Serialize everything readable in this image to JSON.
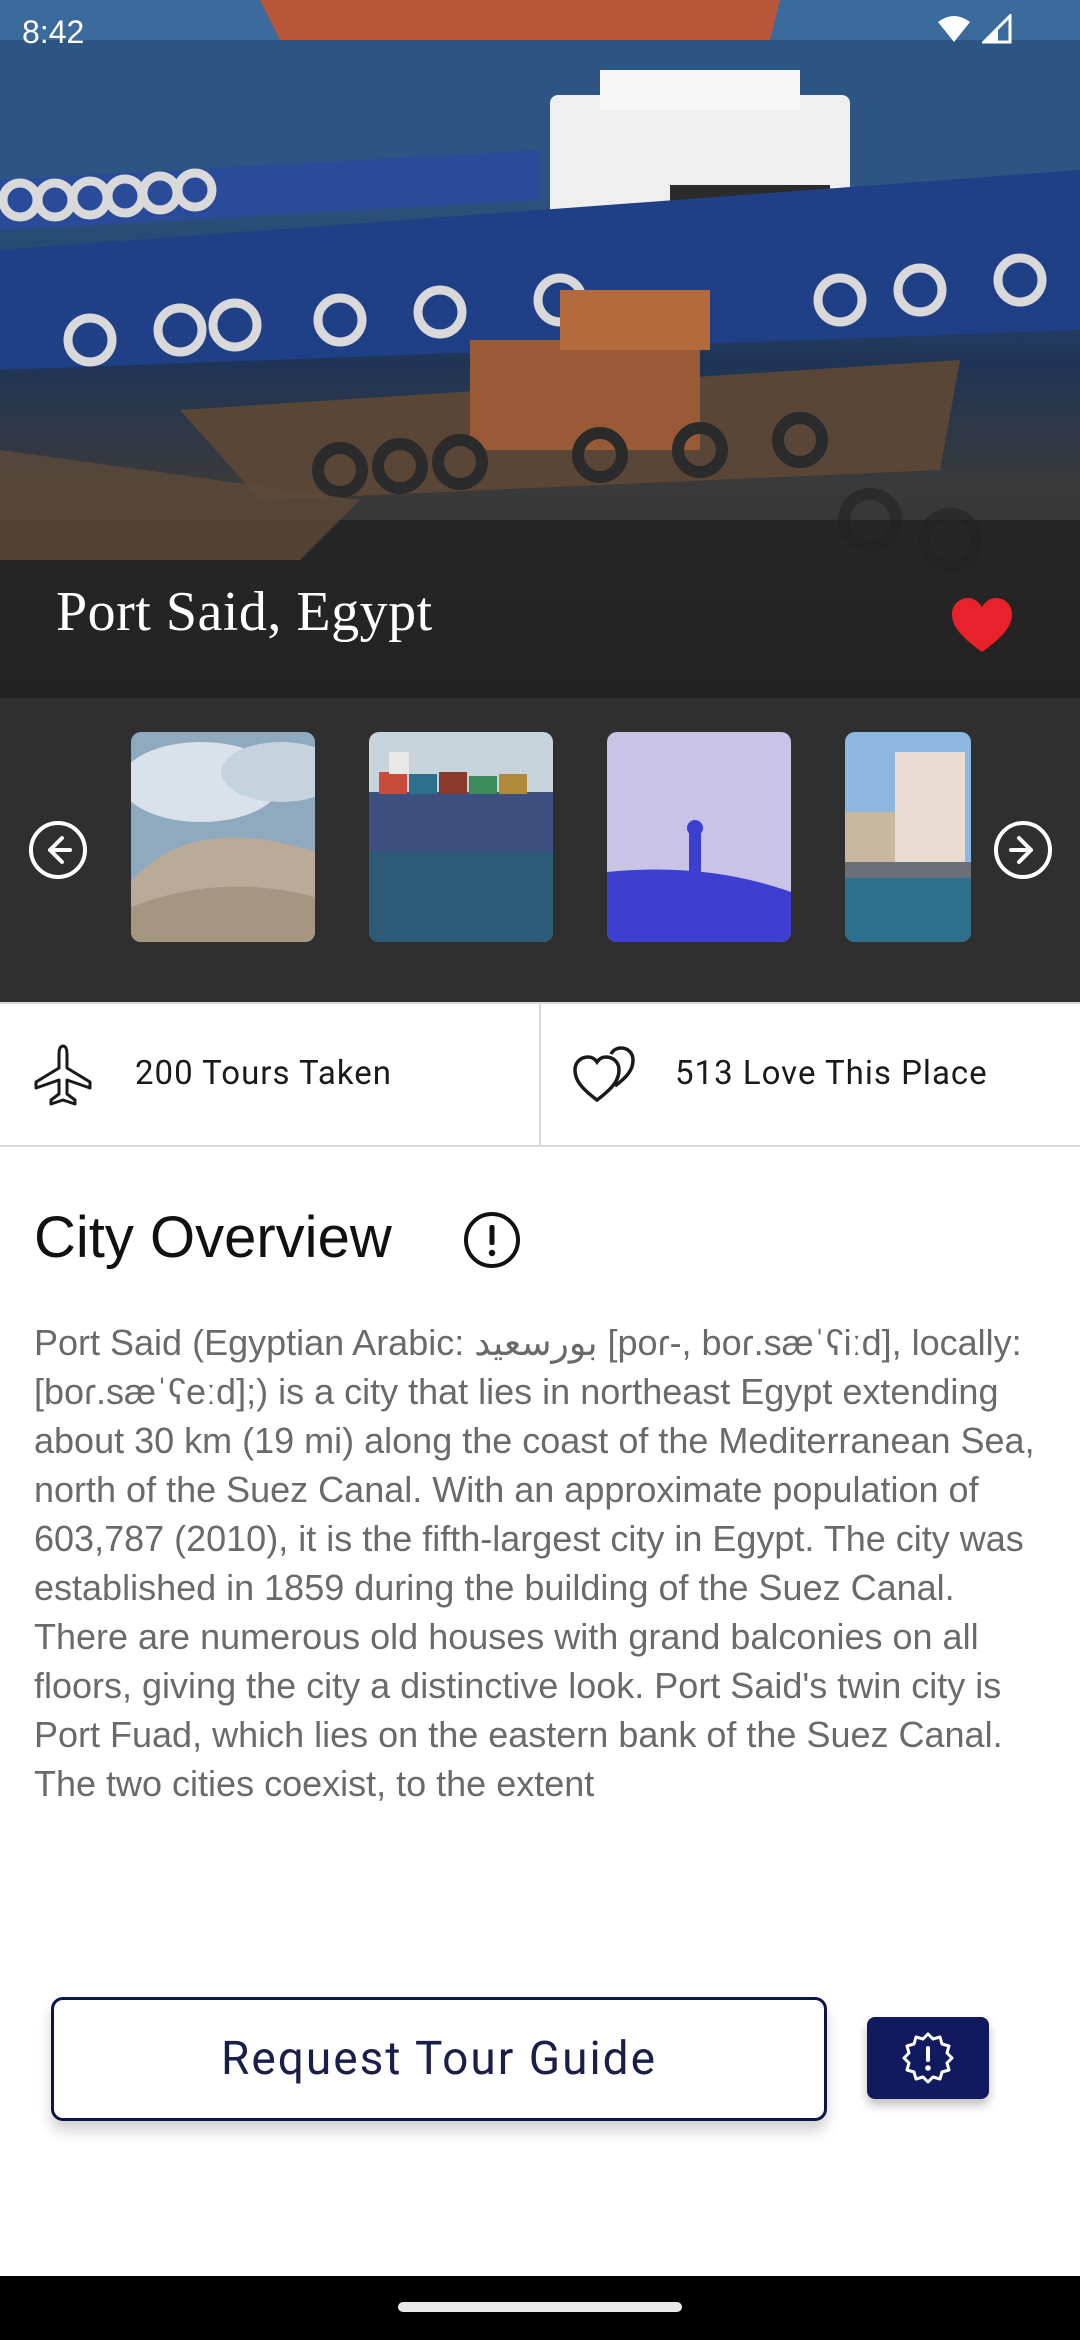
{
  "status_bar": {
    "time": "8:42"
  },
  "hero": {
    "title": "Port Said, Egypt",
    "favorite_icon": "heart-icon"
  },
  "gallery": {
    "prev_icon": "arrow-left-circle-icon",
    "next_icon": "arrow-right-circle-icon",
    "thumbnails": [
      "sand-dune",
      "container-ship",
      "shadow-on-sand",
      "waterfront-buildings"
    ]
  },
  "stats": {
    "tours": {
      "icon": "airplane-icon",
      "label": "200 Tours Taken"
    },
    "love": {
      "icon": "hearts-icon",
      "label": "513 Love This Place"
    }
  },
  "overview": {
    "title": "City Overview",
    "info_icon": "info-icon",
    "text": "Port Said (Egyptian Arabic: بورسعيد [poɾ-, boɾ.sæˈʕiːd], locally: [boɾ.sæˈʕeːd];) is a city that lies in northeast Egypt extending about 30 km (19 mi) along the coast of the Mediterranean Sea, north of the Suez Canal. With an approximate population of 603,787 (2010), it is the fifth-largest city in Egypt. The city was established in 1859 during the building of the Suez Canal.\nThere are numerous old houses with grand balconies on all floors, giving the city a distinctive look. Port Said's twin city is Port Fuad, which lies on the eastern bank of the Suez Canal. The two cities coexist, to the extent"
  },
  "actions": {
    "request_label": "Request Tour Guide",
    "report_icon": "report-icon"
  },
  "colors": {
    "primary_dark": "#111a5e",
    "heart_red": "#e8212b",
    "gallery_bg": "#2f2f2f"
  }
}
